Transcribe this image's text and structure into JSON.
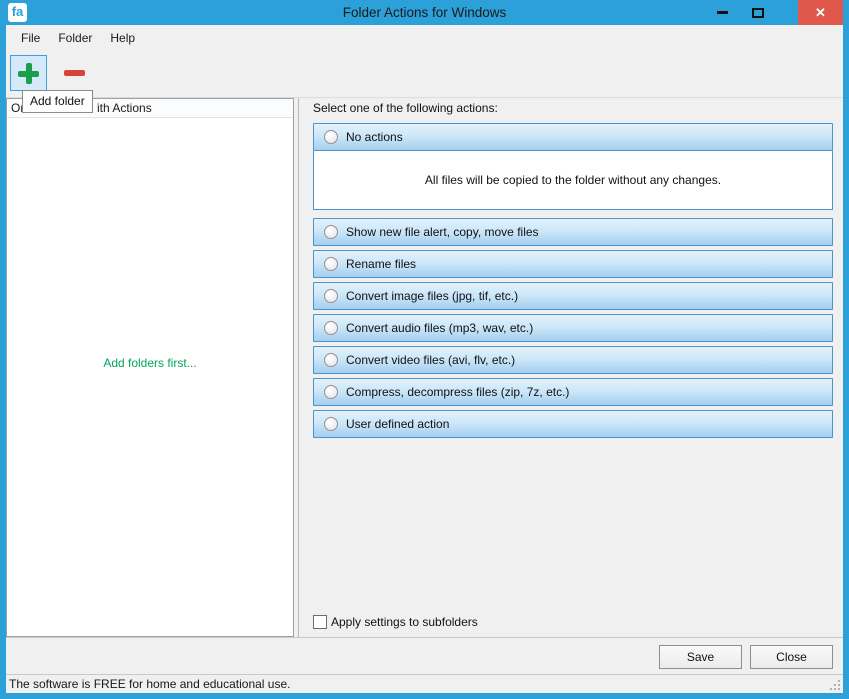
{
  "window": {
    "title": "Folder Actions for Windows",
    "icon_text": "fa"
  },
  "menu": {
    "items": [
      {
        "label": "File"
      },
      {
        "label": "Folder"
      },
      {
        "label": "Help"
      }
    ]
  },
  "toolbar": {
    "add_icon": "plus-icon",
    "remove_icon": "minus-icon",
    "tooltip_text": "Add folder"
  },
  "left_panel": {
    "header_fragment_left": "On",
    "header_fragment_right": "ith Actions",
    "empty_text": "Add folders first...",
    "empty_text_color": "#00a65f"
  },
  "right_panel": {
    "prompt": "Select one of the following actions:",
    "options": [
      {
        "label": "No actions",
        "description": "All files will be copied to the folder without any changes."
      },
      {
        "label": "Show new file alert, copy, move files"
      },
      {
        "label": "Rename files"
      },
      {
        "label": "Convert image files (jpg, tif, etc.)"
      },
      {
        "label": "Convert audio files (mp3, wav, etc.)"
      },
      {
        "label": "Convert video files (avi, flv, etc.)"
      },
      {
        "label": "Compress, decompress files (zip, 7z, etc.)"
      },
      {
        "label": "User defined action"
      }
    ],
    "subfolders_checkbox_label": "Apply settings to subfolders",
    "subfolders_checked": false
  },
  "buttons": {
    "save": "Save",
    "close": "Close"
  },
  "status_bar": {
    "text": "The software is FREE for home and educational use."
  },
  "colors": {
    "titlebar_blue": "#2ba0d9",
    "close_button_red": "#e0584b",
    "option_bar_border": "#4b94cc",
    "add_plus_green": "#1a9e4c",
    "remove_minus_red": "#d6433b",
    "empty_text_green": "#00a65f"
  }
}
